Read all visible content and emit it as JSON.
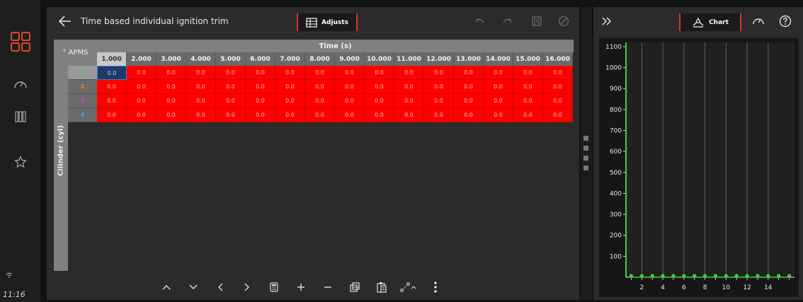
{
  "status": {
    "time": "11:16"
  },
  "nav": [
    {
      "name": "nav-home",
      "icon": "grid-icon"
    },
    {
      "name": "nav-dashboard",
      "icon": "gauge-icon"
    },
    {
      "name": "nav-columns",
      "icon": "columns-icon"
    },
    {
      "name": "nav-favorites",
      "icon": "star-icon"
    }
  ],
  "header": {
    "title": "Time based individual ignition trim",
    "adjusts_label": "Adjusts"
  },
  "table": {
    "row_axis_label": "° APMS",
    "col_axis_label": "Time (s)",
    "y_axis_label": "Cilinder (cyl)",
    "columns": [
      "1.000",
      "2.000",
      "3.000",
      "4.000",
      "5.000",
      "6.000",
      "7.000",
      "8.000",
      "9.000",
      "10.000",
      "11.000",
      "12.000",
      "13.000",
      "14.000",
      "15.000",
      "16.000"
    ],
    "rows": [
      {
        "label": "1",
        "color": "#4fd24f",
        "values": [
          "0.0",
          "0.0",
          "0.0",
          "0.0",
          "0.0",
          "0.0",
          "0.0",
          "0.0",
          "0.0",
          "0.0",
          "0.0",
          "0.0",
          "0.0",
          "0.0",
          "0.0",
          "0.0"
        ]
      },
      {
        "label": "2",
        "color": "#ff7a2a",
        "values": [
          "0.0",
          "0.0",
          "0.0",
          "0.0",
          "0.0",
          "0.0",
          "0.0",
          "0.0",
          "0.0",
          "0.0",
          "0.0",
          "0.0",
          "0.0",
          "0.0",
          "0.0",
          "0.0"
        ]
      },
      {
        "label": "3",
        "color": "#d040d8",
        "values": [
          "0.0",
          "0.0",
          "0.0",
          "0.0",
          "0.0",
          "0.0",
          "0.0",
          "0.0",
          "0.0",
          "0.0",
          "0.0",
          "0.0",
          "0.0",
          "0.0",
          "0.0",
          "0.0"
        ]
      },
      {
        "label": "4",
        "color": "#3fa0ff",
        "values": [
          "0.0",
          "0.0",
          "0.0",
          "0.0",
          "0.0",
          "0.0",
          "0.0",
          "0.0",
          "0.0",
          "0.0",
          "0.0",
          "0.0",
          "0.0",
          "0.0",
          "0.0",
          "0.0"
        ]
      }
    ]
  },
  "toolbar": {
    "icons": [
      "chevron-up-icon",
      "chevron-down-icon",
      "chevron-left-icon",
      "chevron-right-icon",
      "calculator-icon",
      "plus-icon",
      "minus-icon",
      "copy-icon",
      "paste-icon",
      "interpolate-icon",
      "more-icon"
    ]
  },
  "side": {
    "chart_label": "Chart"
  },
  "chart_data": {
    "type": "line",
    "x_ticks": [
      2,
      4,
      6,
      8,
      10,
      12,
      14
    ],
    "y_ticks": [
      100,
      200,
      300,
      400,
      500,
      600,
      700,
      800,
      900,
      1000,
      1100
    ],
    "xlim": [
      0.5,
      16.5
    ],
    "ylim": [
      0,
      1120
    ],
    "series": [
      {
        "color": "#3fd13f",
        "x": [
          1,
          2,
          3,
          4,
          5,
          6,
          7,
          8,
          9,
          10,
          11,
          12,
          13,
          14,
          15,
          16
        ],
        "y": [
          0,
          0,
          0,
          0,
          0,
          0,
          0,
          0,
          0,
          0,
          0,
          0,
          0,
          0,
          0,
          0
        ]
      }
    ]
  }
}
